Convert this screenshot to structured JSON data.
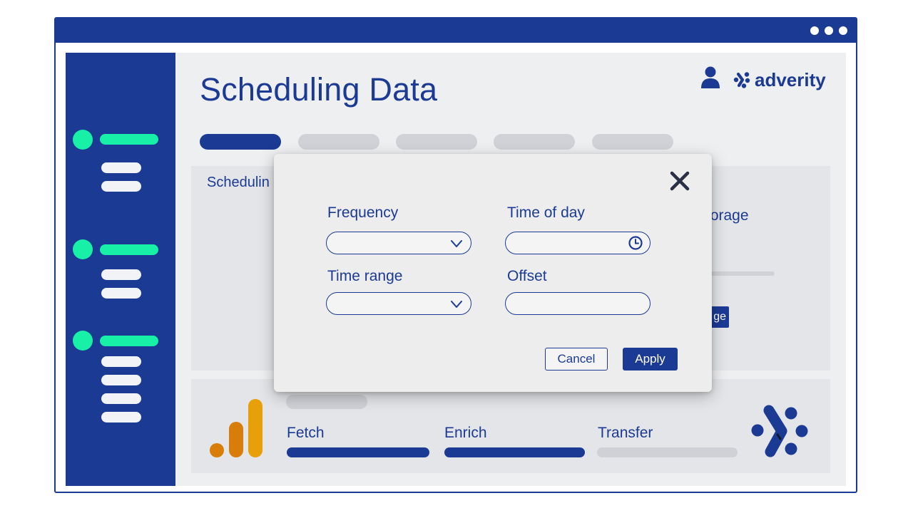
{
  "page": {
    "title": "Scheduling Data"
  },
  "header": {
    "brand": "adverity"
  },
  "background_card": {
    "title": "Schedulin",
    "storage_label": "torage",
    "storage_button": "ge"
  },
  "modal": {
    "frequency_label": "Frequency",
    "frequency_value": "",
    "time_of_day_label": "Time of day",
    "time_of_day_value": "",
    "time_range_label": "Time range",
    "time_range_value": "",
    "offset_label": "Offset",
    "offset_value": "",
    "cancel_label": "Cancel",
    "apply_label": "Apply"
  },
  "pipeline": {
    "steps": [
      {
        "label": "Fetch",
        "complete": true
      },
      {
        "label": "Enrich",
        "complete": true
      },
      {
        "label": "Transfer",
        "complete": false
      }
    ]
  },
  "colors": {
    "primary": "#1b3a94",
    "accent": "#17f0a6",
    "background": "#eeeff1",
    "inactive": "#d0d2d7",
    "analytics_orange": "#e8a008",
    "analytics_dark_orange": "#d87d0a"
  },
  "icons": {
    "user": "user-icon",
    "brand_logo": "adverity-logo-icon",
    "close": "close-icon",
    "dropdown": "chevron-down-icon",
    "time": "clock-icon",
    "source": "google-analytics-icon",
    "destination": "adverity-mark-icon"
  }
}
